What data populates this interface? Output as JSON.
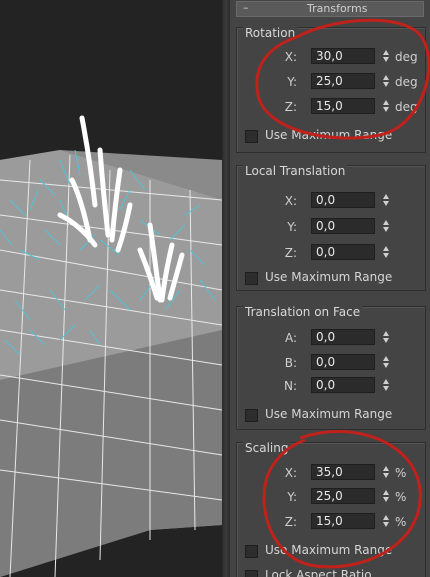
{
  "rollout": {
    "toggle": "–",
    "title": "Transforms"
  },
  "rotation": {
    "title": "Rotation",
    "fields": [
      {
        "label": "X:",
        "value": "30,0",
        "unit": "deg"
      },
      {
        "label": "Y:",
        "value": "25,0",
        "unit": "deg"
      },
      {
        "label": "Z:",
        "value": "15,0",
        "unit": "deg"
      }
    ],
    "max_range_label": "Use Maximum Range"
  },
  "local_translation": {
    "title": "Local Translation",
    "fields": [
      {
        "label": "X:",
        "value": "0,0"
      },
      {
        "label": "Y:",
        "value": "0,0"
      },
      {
        "label": "Z:",
        "value": "0,0"
      }
    ],
    "max_range_label": "Use Maximum Range"
  },
  "translation_on_face": {
    "title": "Translation on Face",
    "fields": [
      {
        "label": "A:",
        "value": "0,0"
      },
      {
        "label": "B:",
        "value": "0,0"
      },
      {
        "label": "N:",
        "value": "0,0"
      }
    ],
    "max_range_label": "Use Maximum Range"
  },
  "scaling": {
    "title": "Scaling",
    "fields": [
      {
        "label": "X:",
        "value": "35,0",
        "unit": "%"
      },
      {
        "label": "Y:",
        "value": "25,0",
        "unit": "%"
      },
      {
        "label": "Z:",
        "value": "15,0",
        "unit": "%"
      }
    ],
    "max_range_label": "Use Maximum Range",
    "lock_aspect_label": "Lock Aspect Ratio"
  },
  "colors": {
    "annotation": "#c0211b",
    "particles": "#4fc3d6",
    "grass": "#ffffff"
  }
}
